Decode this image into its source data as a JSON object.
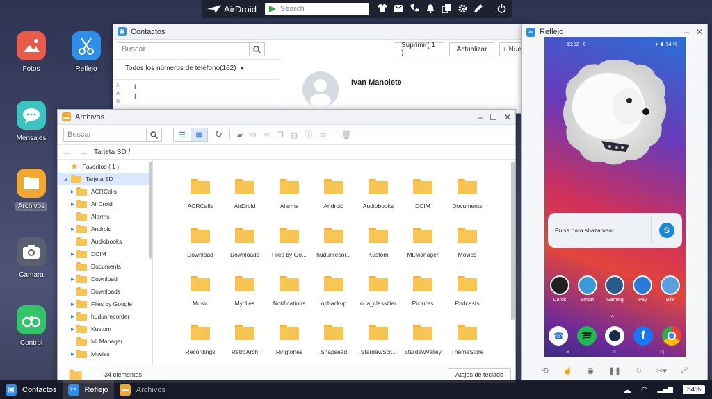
{
  "topbar": {
    "brand": "AirDroid",
    "search_placeholder": "Search"
  },
  "desktop": {
    "icons": [
      {
        "label": "Fotos",
        "color": "#e85a4a"
      },
      {
        "label": "Reflejo",
        "color": "#2f8ee8"
      },
      {
        "label": "Mensajes",
        "color": "#3cc3c0"
      },
      {
        "label": "Archivos",
        "color": "#f0a830"
      },
      {
        "label": "Cámara",
        "color": "#5a6070"
      },
      {
        "label": "Control",
        "color": "#34c26a"
      }
    ]
  },
  "contactos": {
    "title": "Contactos",
    "search_placeholder": "Buscar",
    "delete_btn": "Suprimir( 1 )",
    "update_btn": "Actualizar",
    "new_btn": "+ Nue",
    "filter": "Todos los números de teléfono(162)",
    "index_letters": [
      "#",
      "A",
      "B"
    ],
    "contact_name": "Ivan Manolete"
  },
  "archivos": {
    "title": "Archivos",
    "search_placeholder": "Buscar",
    "breadcrumb": "Tarjeta SD /",
    "tree": {
      "favorites": "Favoritos ( 1 )",
      "root": "Tarjeta SD",
      "items": [
        "ACRCalls",
        "AirDroid",
        "Alarms",
        "Android",
        "Audiobooks",
        "DCIM",
        "Documents",
        "Download",
        "Downloads",
        "Files by Google",
        "hudunrecorder",
        "Kustom",
        "MLManager",
        "Movies"
      ]
    },
    "folders": [
      "ACRCalls",
      "AirDroid",
      "Alarms",
      "Android",
      "Audiobooks",
      "DCIM",
      "Documents",
      "Download",
      "Downloads",
      "Files by Go...",
      "hudunrecor...",
      "Kustom",
      "MLManager",
      "Movies",
      "Music",
      "My files",
      "Notifications",
      "opbackup",
      "oua_classifier",
      "Pictures",
      "Podcasts",
      "Recordings",
      "RetroArch",
      "Ringtones",
      "Snapseed",
      "StardewScr...",
      "StardewValley",
      "ThemeStore"
    ],
    "status": "34 elementos",
    "shortcuts_btn": "Atajos de teclado"
  },
  "reflejo": {
    "title": "Reflejo",
    "phone": {
      "time": "13:52",
      "battery": "54 %",
      "widget_text": "Pulsa para shazamear",
      "apps": [
        {
          "label": "Cards",
          "color": "#222222"
        },
        {
          "label": "Smart",
          "color": "#3a9ad9"
        },
        {
          "label": "Gaming",
          "color": "#2a5a8a"
        },
        {
          "label": "Pay",
          "color": "#2a7ad9"
        },
        {
          "label": "Bills",
          "color": "#5aa0e0"
        }
      ],
      "dock": [
        {
          "name": "phone-app",
          "color": "#ffffff"
        },
        {
          "name": "spotify-app",
          "color": "#1db954"
        },
        {
          "name": "camera-app",
          "color": "#1a2a4a"
        },
        {
          "name": "facebook-app",
          "color": "#1877f2"
        },
        {
          "name": "chrome-app",
          "color": "#ffffff"
        }
      ]
    }
  },
  "taskbar": {
    "items": [
      {
        "label": "Contactos",
        "color": "#2f8ee8"
      },
      {
        "label": "Reflejo",
        "color": "#2f8ee8"
      },
      {
        "label": "Archivos",
        "color": "#f0a830"
      }
    ],
    "battery": "54%"
  }
}
